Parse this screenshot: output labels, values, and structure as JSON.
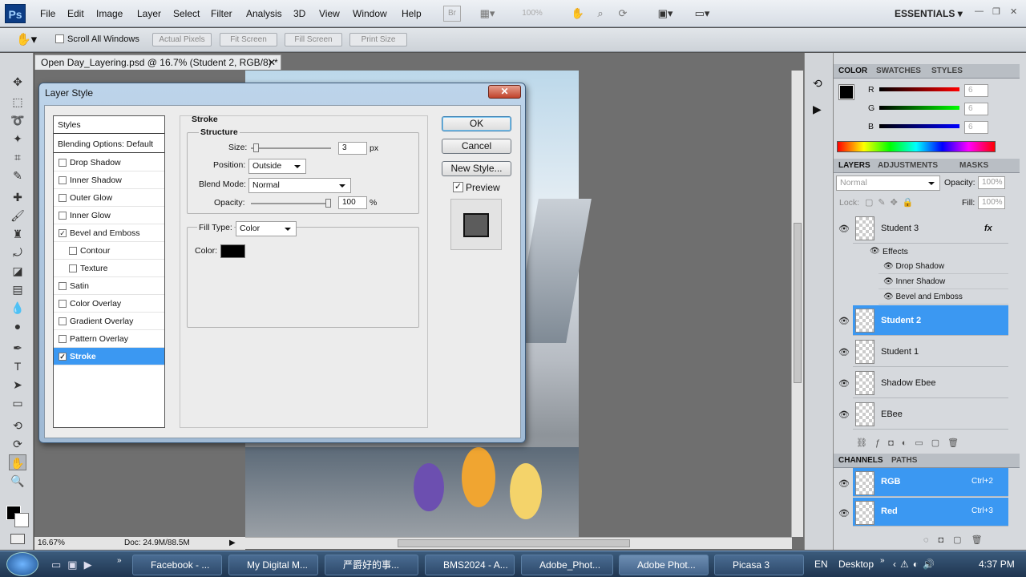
{
  "app": {
    "logo": "Ps"
  },
  "menu": [
    "File",
    "Edit",
    "Image",
    "Layer",
    "Select",
    "Filter",
    "Analysis",
    "3D",
    "View",
    "Window",
    "Help"
  ],
  "toolbar": {
    "bridge": "Br",
    "zoom": "100%",
    "workspace": "ESSENTIALS"
  },
  "options": {
    "scroll_all": "Scroll All Windows",
    "actual": "Actual Pixels",
    "fit": "Fit Screen",
    "fill": "Fill Screen",
    "print": "Print Size"
  },
  "document": {
    "tab": "Open Day_Layering.psd @ 16.7% (Student 2, RGB/8) *",
    "zoom": "16.67%",
    "doc": "Doc: 24.9M/88.5M"
  },
  "color_panel": {
    "tabs": [
      "COLOR",
      "SWATCHES",
      "STYLES"
    ],
    "r": "R",
    "g": "G",
    "b": "B",
    "r_val": "6",
    "g_val": "6",
    "b_val": "6"
  },
  "layers_panel": {
    "tabs": [
      "LAYERS",
      "ADJUSTMENTS",
      "MASKS"
    ],
    "blend": "Normal",
    "opacity_label": "Opacity:",
    "opacity": "100%",
    "lock_label": "Lock:",
    "fill_label": "Fill:",
    "fill": "100%",
    "fx": "fx",
    "effects_label": "Effects",
    "effects": [
      "Drop Shadow",
      "Inner Shadow",
      "Bevel and Emboss"
    ],
    "layers": [
      "Student 3",
      "Student 2",
      "Student 1",
      "Shadow Ebee",
      "EBee"
    ]
  },
  "channels_panel": {
    "tabs": [
      "CHANNELS",
      "PATHS"
    ],
    "channels": [
      {
        "name": "RGB",
        "shortcut": "Ctrl+2"
      },
      {
        "name": "Red",
        "shortcut": "Ctrl+3"
      }
    ]
  },
  "dialog": {
    "title": "Layer Style",
    "close": "✕",
    "styles_header": "Styles",
    "blending": "Blending Options: Default",
    "items": [
      {
        "label": "Drop Shadow",
        "checked": ""
      },
      {
        "label": "Inner Shadow",
        "checked": ""
      },
      {
        "label": "Outer Glow",
        "checked": ""
      },
      {
        "label": "Inner Glow",
        "checked": ""
      },
      {
        "label": "Bevel and Emboss",
        "checked": "✓"
      },
      {
        "label": "Contour",
        "checked": ""
      },
      {
        "label": "Texture",
        "checked": ""
      },
      {
        "label": "Satin",
        "checked": ""
      },
      {
        "label": "Color Overlay",
        "checked": ""
      },
      {
        "label": "Gradient Overlay",
        "checked": ""
      },
      {
        "label": "Pattern Overlay",
        "checked": ""
      },
      {
        "label": "Stroke",
        "checked": "✓"
      }
    ],
    "section": "Stroke",
    "structure": "Structure",
    "size_label": "Size:",
    "size": "3",
    "size_unit": "px",
    "size_level": 0.03,
    "position_label": "Position:",
    "position": "Outside",
    "blend_label": "Blend Mode:",
    "blend": "Normal",
    "opacity_label": "Opacity:",
    "opacity": "100",
    "opacity_unit": "%",
    "opacity_level": 1.0,
    "filltype_label": "Fill Type:",
    "filltype": "Color",
    "color_label": "Color:",
    "color": "#000000",
    "ok": "OK",
    "cancel": "Cancel",
    "new_style": "New Style...",
    "preview": "Preview",
    "preview_checked": "✓"
  },
  "taskbar": {
    "tasks": [
      "Facebook - ...",
      "My Digital M...",
      "严爵好的事...",
      "BMS2024 - A...",
      "Adobe_Phot...",
      "Adobe Phot...",
      "Picasa 3"
    ],
    "lang": "EN",
    "desktop": "Desktop",
    "time": "4:37 PM"
  }
}
